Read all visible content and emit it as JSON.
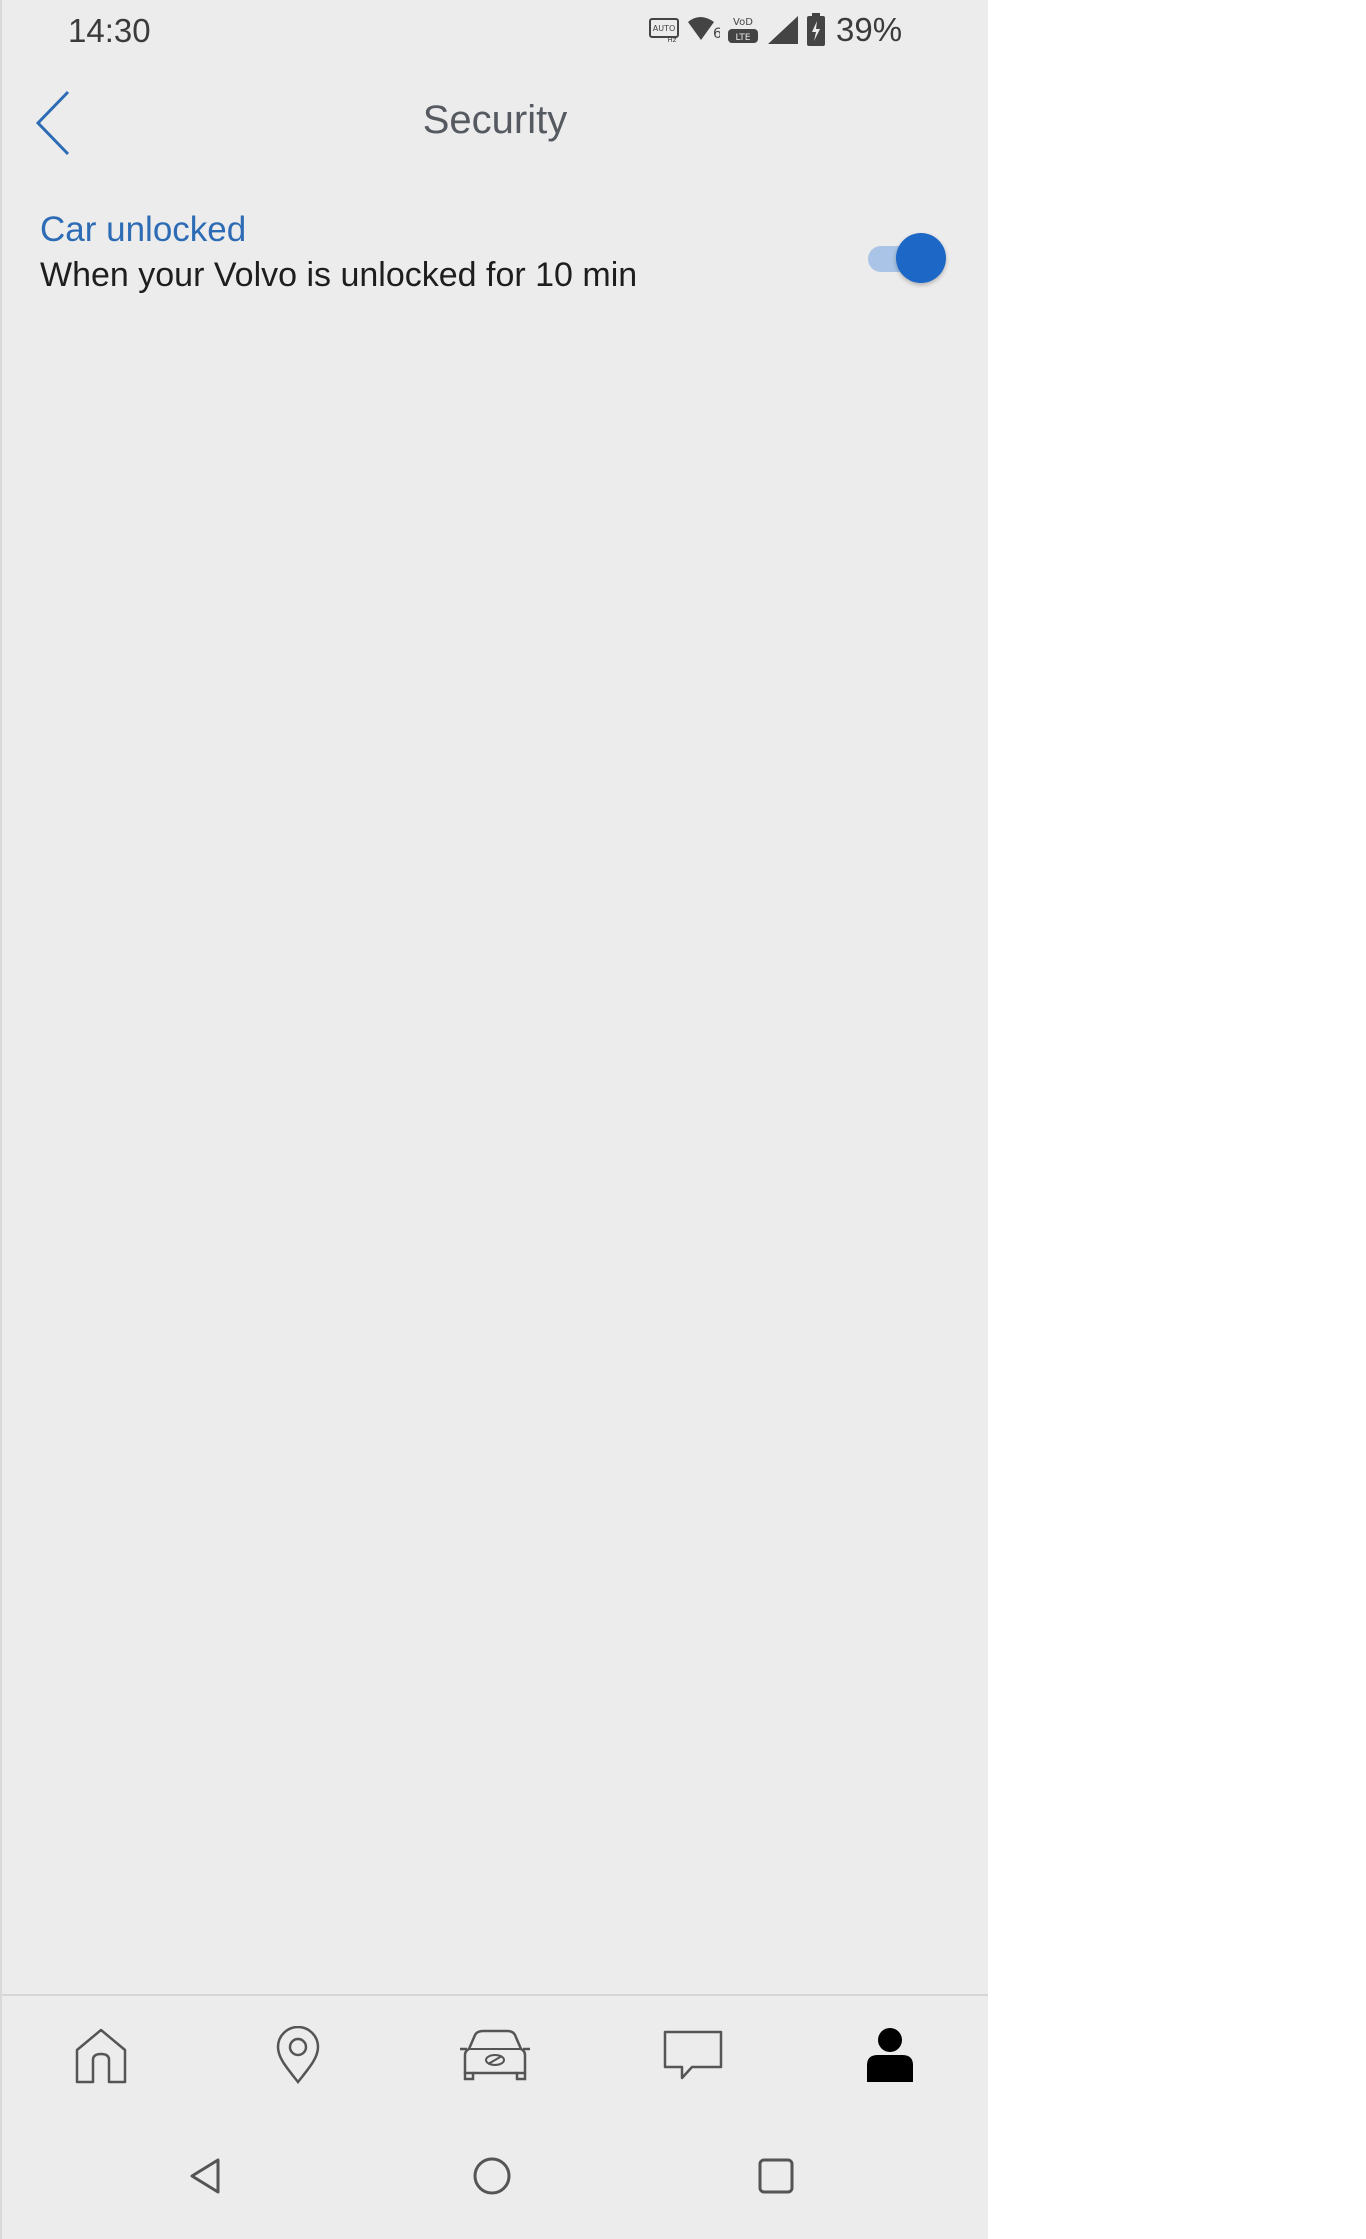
{
  "status_bar": {
    "time": "14:30",
    "battery": "39%",
    "icons": [
      "auto-hz-icon",
      "wifi-6-icon",
      "volte-icon",
      "signal-icon",
      "battery-charging-icon"
    ]
  },
  "header": {
    "title": "Security",
    "back_icon": "chevron-left-icon"
  },
  "settings": [
    {
      "title": "Car unlocked",
      "description": "When your Volvo is unlocked for 10 min",
      "enabled": true
    }
  ],
  "bottom_nav": {
    "items": [
      {
        "icon": "home-icon",
        "active": false
      },
      {
        "icon": "map-pin-icon",
        "active": false
      },
      {
        "icon": "car-icon",
        "active": false
      },
      {
        "icon": "message-icon",
        "active": false
      },
      {
        "icon": "profile-icon",
        "active": true
      }
    ]
  },
  "system_nav": {
    "icons": [
      "triangle-back-icon",
      "circle-home-icon",
      "square-recents-icon"
    ]
  },
  "colors": {
    "background": "#ececed",
    "accent": "#1d68c6",
    "accent_light": "#a9c4e6",
    "link_text": "#2d6cb5",
    "title_text": "#555a60"
  }
}
